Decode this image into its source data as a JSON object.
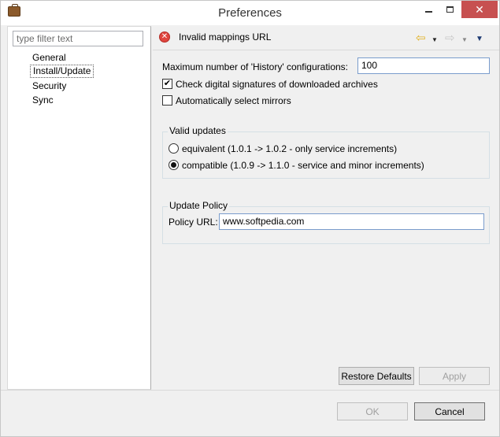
{
  "window": {
    "title": "Preferences"
  },
  "sidebar": {
    "filter_placeholder": "type filter text",
    "items": [
      {
        "label": "General",
        "selected": false
      },
      {
        "label": "Install/Update",
        "selected": true
      },
      {
        "label": "Security",
        "selected": false
      },
      {
        "label": "Sync",
        "selected": false
      }
    ]
  },
  "header": {
    "message": "Invalid mappings URL",
    "icons": [
      "error-icon",
      "back-arrow-icon",
      "forward-arrow-icon",
      "view-menu-icon"
    ]
  },
  "main": {
    "history_label": "Maximum number of 'History' configurations:",
    "history_value": "100",
    "check_signatures_label": "Check digital signatures of downloaded archives",
    "check_signatures_checked": true,
    "auto_mirrors_label": "Automatically select mirrors",
    "auto_mirrors_checked": false,
    "valid_updates": {
      "title": "Valid updates",
      "options": [
        {
          "label": "equivalent (1.0.1 -> 1.0.2 - only service increments)",
          "selected": false
        },
        {
          "label": "compatible (1.0.9 -> 1.1.0 - service and minor increments)",
          "selected": true
        }
      ]
    },
    "update_policy": {
      "title": "Update Policy",
      "url_label": "Policy URL:",
      "url_value": "www.softpedia.com"
    }
  },
  "buttons": {
    "restore_defaults": "Restore Defaults",
    "apply": "Apply",
    "ok": "OK",
    "cancel": "Cancel"
  }
}
